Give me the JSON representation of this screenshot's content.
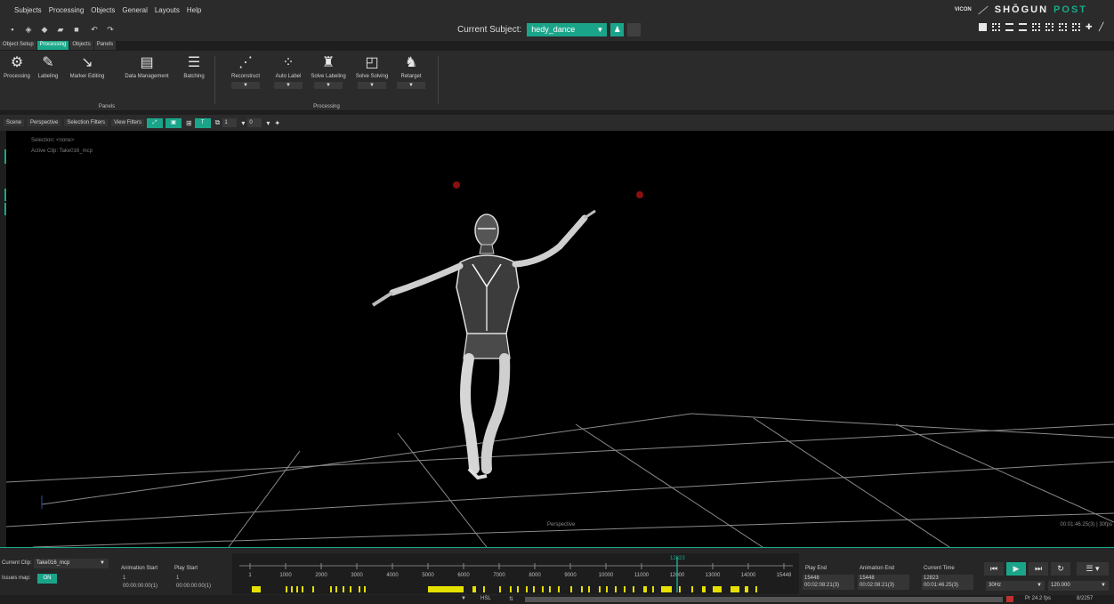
{
  "menu": [
    "Subjects",
    "Processing",
    "Objects",
    "General",
    "Layouts",
    "Help"
  ],
  "brand": {
    "vicon": "VICON",
    "shogun": "SHŌGUN",
    "post": "POST"
  },
  "quick_toolbar": [
    "new-icon",
    "open-icon",
    "import-icon",
    "folder-icon",
    "save-icon",
    "undo-icon",
    "redo-icon"
  ],
  "current_subject": {
    "label": "Current Subject:",
    "value": "hedy_dance"
  },
  "ribbon_tabs": [
    {
      "label": "Object Setup",
      "active": false
    },
    {
      "label": "Processing",
      "active": true
    },
    {
      "label": "Objects",
      "active": false
    },
    {
      "label": "Panels",
      "active": false
    }
  ],
  "ribbon": {
    "panels_group": {
      "label": "Panels",
      "buttons": [
        "Processing",
        "Labeling",
        "Marker Editing",
        "Data Management",
        "Batching"
      ]
    },
    "processing_group": {
      "label": "Processing",
      "buttons": [
        "Reconstruct",
        "Auto Label",
        "Solve Labeling",
        "Solve Solving",
        "Retarget"
      ]
    }
  },
  "viewbar": {
    "camera": "Scene",
    "view": "Perspective",
    "selection_filters": "Selection Filters",
    "view_filters": "View Filters",
    "field1": "1",
    "field2": "0"
  },
  "viewport": {
    "selection": "Selection: <none>",
    "active_clip": "Active Clip: Take016_mcp",
    "view_label": "Perspective",
    "time_readout": "00:01:46.25(3) | 30fps"
  },
  "timeline": {
    "current_clip_label": "Current Clip:",
    "current_clip_value": "Take016_mcp",
    "issues_label": "Issues map:",
    "issues_state": "ON",
    "animation_start": {
      "label": "Animation Start",
      "frame": "1",
      "tc": "00:00:00:00(1)"
    },
    "play_start": {
      "label": "Play Start",
      "frame": "1",
      "tc": "00:00:00:00(1)"
    },
    "ticks": [
      "1",
      "1000",
      "2000",
      "3000",
      "4000",
      "5000",
      "6000",
      "7000",
      "8000",
      "9000",
      "10000",
      "11000",
      "12000",
      "13000",
      "14000",
      "15448"
    ],
    "marker": "12823",
    "playhead_fraction": 0.8,
    "play_end": {
      "label": "Play End",
      "frame": "15448",
      "tc": "00:02:08:21(3)"
    },
    "animation_end": {
      "label": "Animation End",
      "frame": "15448",
      "tc": "00:02:08:21(3)"
    },
    "current_time": {
      "label": "Current Time",
      "frame": "12823",
      "tc": "00:01:46.25(3)"
    },
    "transport": [
      "skip-start-icon",
      "play-icon",
      "skip-end-icon",
      "loop-icon"
    ],
    "rate": "30Hz",
    "speed": "120.000"
  },
  "status": {
    "mode": "HSL",
    "fps": "Pr 24.2 fps",
    "count": "8/2257"
  },
  "colors": {
    "accent": "#1aa58a",
    "issue": "#e6e000",
    "background": "#000000"
  }
}
